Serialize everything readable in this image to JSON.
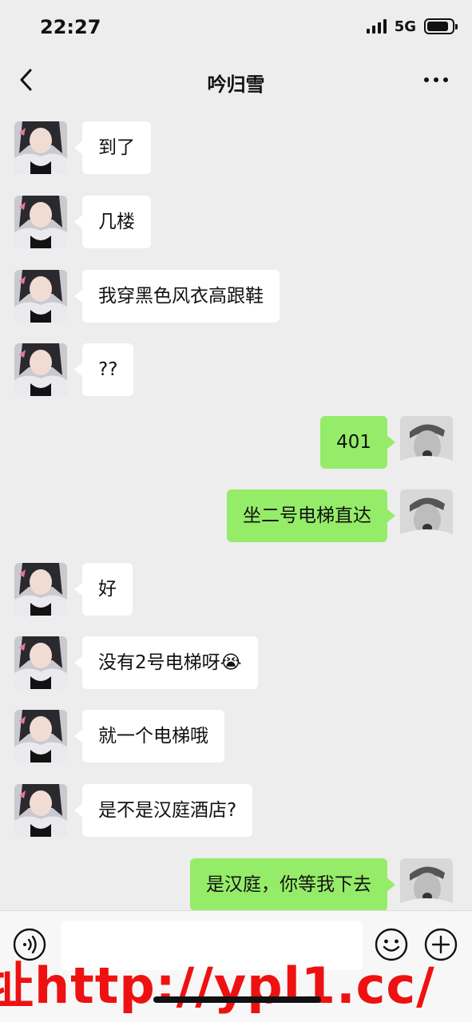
{
  "status_bar": {
    "time": "22:27",
    "network": "5G",
    "battery_level": 0.85
  },
  "header": {
    "title": "吟归雪",
    "back_icon": "chevron-left-icon",
    "more_icon": "more-dots-icon"
  },
  "messages": [
    {
      "side": "left",
      "text": "到了"
    },
    {
      "side": "left",
      "text": "几楼"
    },
    {
      "side": "left",
      "text": "我穿黑色风衣高跟鞋"
    },
    {
      "side": "left",
      "text": "??"
    },
    {
      "side": "right",
      "text": "401"
    },
    {
      "side": "right",
      "text": "坐二号电梯直达"
    },
    {
      "side": "left",
      "text": "好"
    },
    {
      "side": "left",
      "text": "没有2号电梯呀😭"
    },
    {
      "side": "left",
      "text": "就一个电梯哦"
    },
    {
      "side": "left",
      "text": "是不是汉庭酒店?"
    },
    {
      "side": "right",
      "text": "是汉庭，你等我下去"
    }
  ],
  "input_bar": {
    "voice_icon": "voice-icon",
    "emoji_icon": "emoji-icon",
    "plus_icon": "plus-icon",
    "placeholder": ""
  },
  "watermark": "址http://ypl1.cc/"
}
